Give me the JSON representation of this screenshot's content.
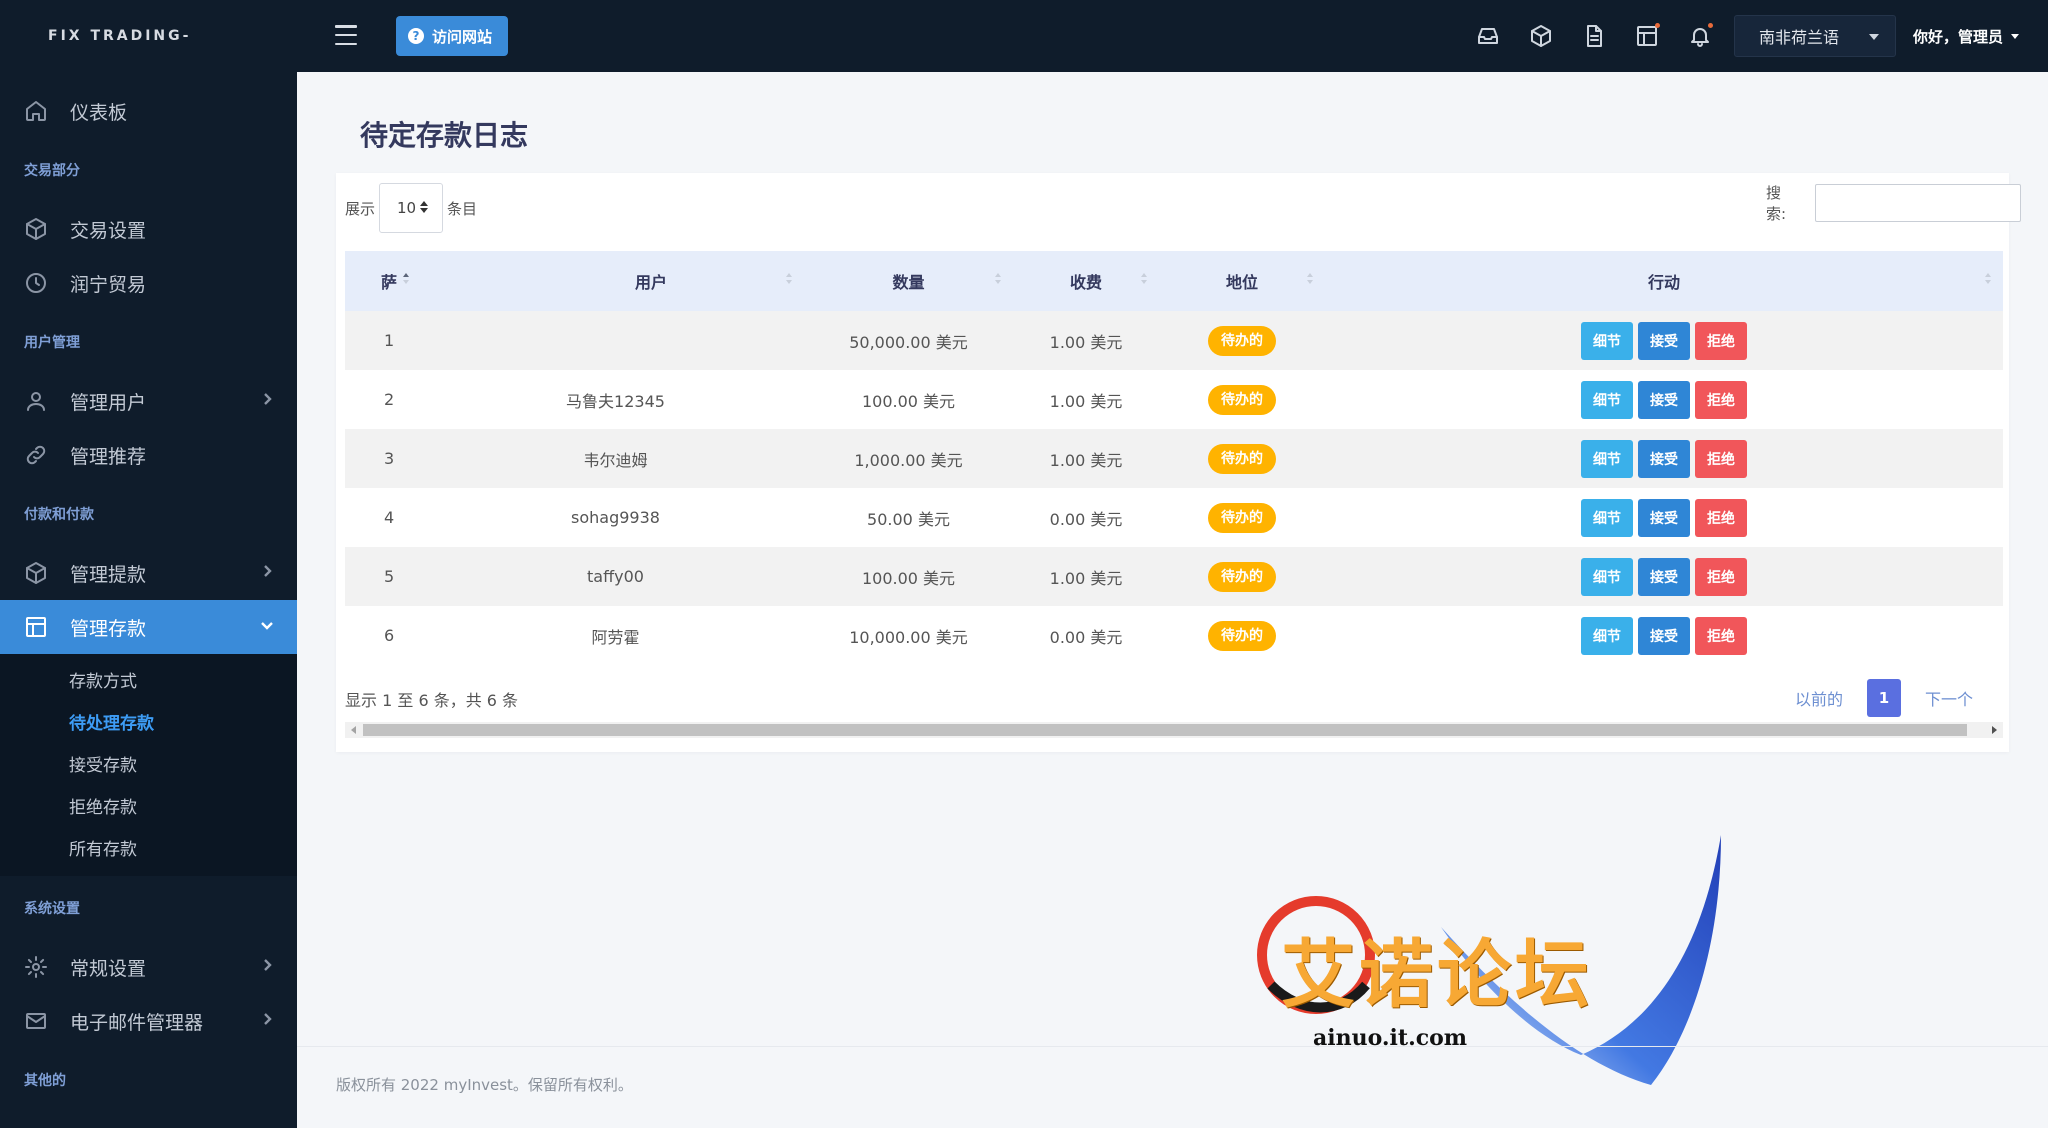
{
  "brand": "FIX TRADING-",
  "sidebar": {
    "dashboard": "仪表板",
    "sections": {
      "trading": "交易部分",
      "users": "用户管理",
      "payments": "付款和付款",
      "system": "系统设置",
      "other": "其他的"
    },
    "items": {
      "trade_settings": "交易设置",
      "runing_trade": "润宁贸易",
      "manage_users": "管理用户",
      "manage_referrals": "管理推荐",
      "manage_withdrawals": "管理提款",
      "manage_deposits": "管理存款",
      "general_settings": "常规设置",
      "email_manager": "电子邮件管理器"
    },
    "deposit_submenu": [
      "存款方式",
      "待处理存款",
      "接受存款",
      "拒绝存款",
      "所有存款"
    ],
    "icons": {
      "dashboard": "home-icon",
      "trade_settings": "cube-icon",
      "runing_trade": "clock-icon",
      "manage_users": "user-icon",
      "manage_referrals": "link-icon",
      "manage_withdrawals": "cube-icon",
      "manage_deposits": "layout-icon",
      "general_settings": "gear-icon",
      "email_manager": "mail-icon"
    }
  },
  "topbar": {
    "visit_site": "访问网站",
    "language": "南非荷兰语",
    "greeting": "你好，管理员",
    "icons": [
      "inbox-icon",
      "box-icon",
      "file-icon",
      "layout-icon",
      "bell-icon"
    ]
  },
  "page": {
    "title": "待定存款日志",
    "show_prefix": "展示",
    "show_value": "10",
    "show_suffix": "条目",
    "search_label": "搜索:",
    "search_value": ""
  },
  "table": {
    "headers": [
      "萨",
      "用户",
      "数量",
      "收费",
      "地位",
      "行动"
    ],
    "rows": [
      {
        "sn": "1",
        "user": "",
        "amount": "50,000.00 美元",
        "fee": "1.00 美元",
        "status": "待办的"
      },
      {
        "sn": "2",
        "user": "马鲁夫12345",
        "amount": "100.00 美元",
        "fee": "1.00 美元",
        "status": "待办的"
      },
      {
        "sn": "3",
        "user": "韦尔迪姆",
        "amount": "1,000.00 美元",
        "fee": "1.00 美元",
        "status": "待办的"
      },
      {
        "sn": "4",
        "user": "sohag9938",
        "amount": "50.00 美元",
        "fee": "0.00 美元",
        "status": "待办的"
      },
      {
        "sn": "5",
        "user": "taffy00",
        "amount": "100.00 美元",
        "fee": "1.00 美元",
        "status": "待办的"
      },
      {
        "sn": "6",
        "user": "阿劳霍",
        "amount": "10,000.00 美元",
        "fee": "0.00 美元",
        "status": "待办的"
      }
    ],
    "actions": {
      "detail": "细节",
      "accept": "接受",
      "reject": "拒绝"
    }
  },
  "pagination": {
    "info": "显示 1 至 6 条，共 6 条",
    "prev": "以前的",
    "current": "1",
    "next": "下一个"
  },
  "watermark": {
    "text": "艾诺论坛",
    "url": "ainuo.it.com"
  },
  "footer": "版权所有 2022 myInvest。保留所有权利。",
  "colors": {
    "sidebar_bg": "#0f1c2b",
    "accent": "#3a8bd9",
    "pending_badge": "#ffb300",
    "detail_btn": "#3ab0ea",
    "accept_btn": "#2f86d6",
    "reject_btn": "#f1565a"
  }
}
